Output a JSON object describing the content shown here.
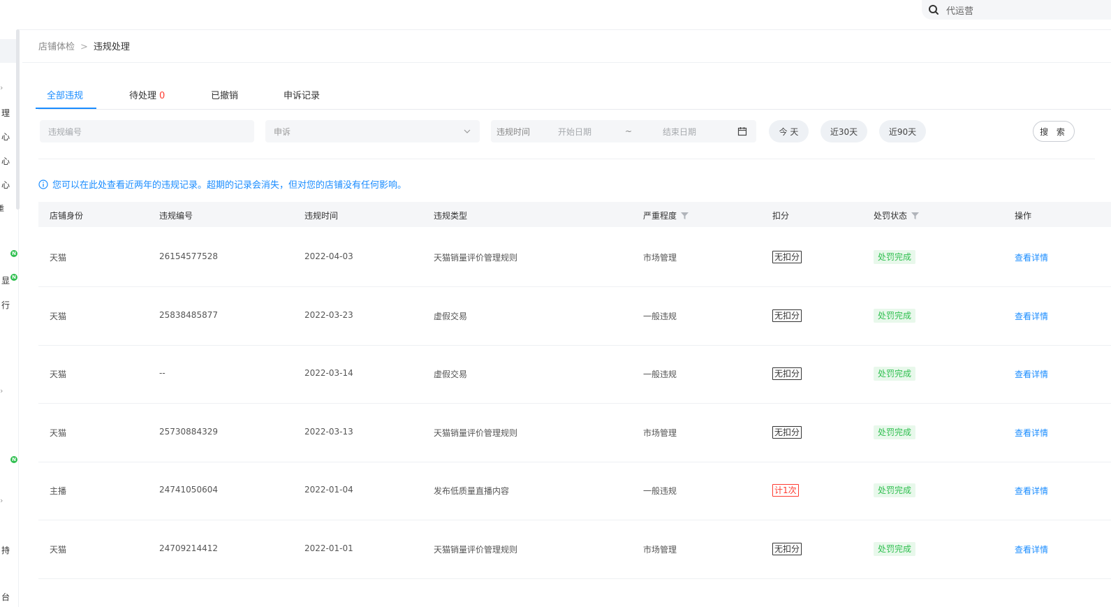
{
  "top_search": {
    "placeholder": "代运营"
  },
  "sidebar": {
    "items": [
      "理",
      "心",
      "心",
      "心",
      "重",
      "显",
      "行",
      "持",
      "台"
    ],
    "badge": "N"
  },
  "breadcrumb": {
    "parent": "店铺体检",
    "separator": ">",
    "current": "违规处理"
  },
  "tabs": [
    {
      "label": "全部违规"
    },
    {
      "label": "待处理",
      "count": "0"
    },
    {
      "label": "已撤销"
    },
    {
      "label": "申诉记录"
    }
  ],
  "filters": {
    "violation_id_placeholder": "违规编号",
    "appeal_select": "申诉",
    "time_label": "违规时间",
    "start_placeholder": "开始日期",
    "range_sep": "~",
    "end_placeholder": "结束日期",
    "quick": [
      "今 天",
      "近30天",
      "近90天"
    ],
    "search_label": "搜 索"
  },
  "notice": "您可以在此处查看近两年的违规记录。超期的记录会消失，但对您的店铺没有任何影响。",
  "table": {
    "headers": [
      "店铺身份",
      "违规编号",
      "违规时间",
      "违规类型",
      "严重程度",
      "扣分",
      "处罚状态",
      "操作"
    ],
    "rows": [
      {
        "identity": "天猫",
        "id": "26154577528",
        "time": "2022-04-03",
        "type": "天猫销量评价管理规则",
        "severity": "市场管理",
        "score": "无扣分",
        "score_red": false,
        "status": "处罚完成",
        "action": "查看详情"
      },
      {
        "identity": "天猫",
        "id": "25838485877",
        "time": "2022-03-23",
        "type": "虚假交易",
        "severity": "一般违规",
        "score": "无扣分",
        "score_red": false,
        "status": "处罚完成",
        "action": "查看详情"
      },
      {
        "identity": "天猫",
        "id": "--",
        "time": "2022-03-14",
        "type": "虚假交易",
        "severity": "一般违规",
        "score": "无扣分",
        "score_red": false,
        "status": "处罚完成",
        "action": "查看详情"
      },
      {
        "identity": "天猫",
        "id": "25730884329",
        "time": "2022-03-13",
        "type": "天猫销量评价管理规则",
        "severity": "市场管理",
        "score": "无扣分",
        "score_red": false,
        "status": "处罚完成",
        "action": "查看详情"
      },
      {
        "identity": "主播",
        "id": "24741050604",
        "time": "2022-01-04",
        "type": "发布低质量直播内容",
        "severity": "一般违规",
        "score": "计1次",
        "score_red": true,
        "status": "处罚完成",
        "action": "查看详情"
      },
      {
        "identity": "天猫",
        "id": "24709214412",
        "time": "2022-01-01",
        "type": "天猫销量评价管理规则",
        "severity": "市场管理",
        "score": "无扣分",
        "score_red": false,
        "status": "处罚完成",
        "action": "查看详情"
      }
    ]
  },
  "colors": {
    "accent": "#1a8cff",
    "danger": "#ff3b30",
    "success": "#2fbf4f"
  }
}
